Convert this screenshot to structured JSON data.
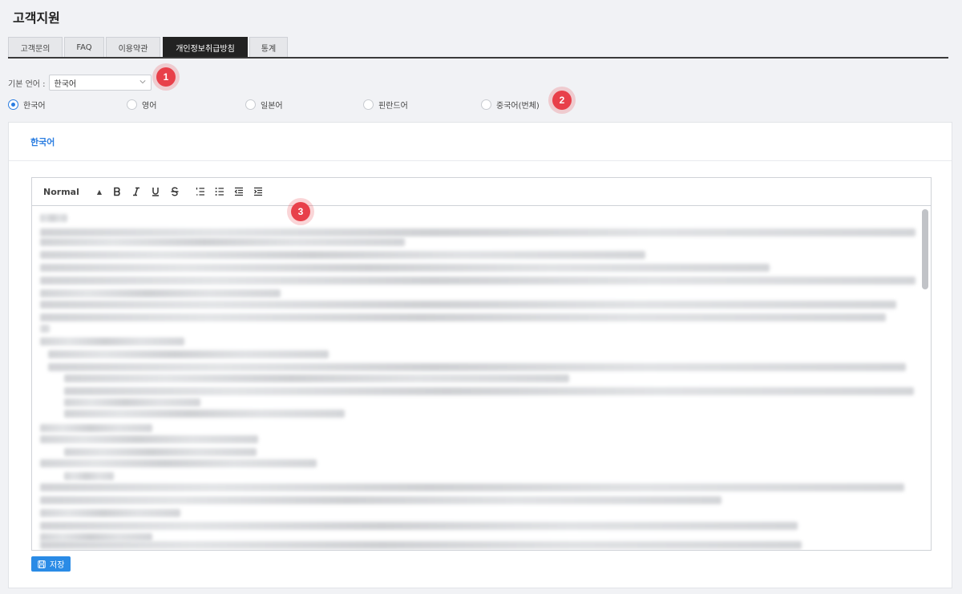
{
  "page": {
    "title": "고객지원"
  },
  "tabs": [
    {
      "label": "고객문의"
    },
    {
      "label": "FAQ"
    },
    {
      "label": "이용약관"
    },
    {
      "label": "개인정보취급방침"
    },
    {
      "label": "통계"
    }
  ],
  "active_tab": "개인정보취급방침",
  "language": {
    "label": "기본 언어 :",
    "selected": "한국어"
  },
  "radios": [
    {
      "label": "한국어",
      "checked": true
    },
    {
      "label": "영어",
      "checked": false
    },
    {
      "label": "일본어",
      "checked": false
    },
    {
      "label": "핀란드어",
      "checked": false
    },
    {
      "label": "중국어(번체)",
      "checked": false
    }
  ],
  "panel": {
    "header": "한국어"
  },
  "editor": {
    "format": "Normal",
    "buttons": [
      "bold-icon",
      "italic-icon",
      "underline-icon",
      "strikethrough-icon",
      "ordered-list-icon",
      "bullet-list-icon",
      "outdent-icon",
      "indent-icon"
    ]
  },
  "save": {
    "label": "저장"
  },
  "markers": [
    "1",
    "2",
    "3"
  ],
  "colors": {
    "accent": "#2a7de1",
    "marker": "#e8404a",
    "active_tab": "#222222"
  }
}
